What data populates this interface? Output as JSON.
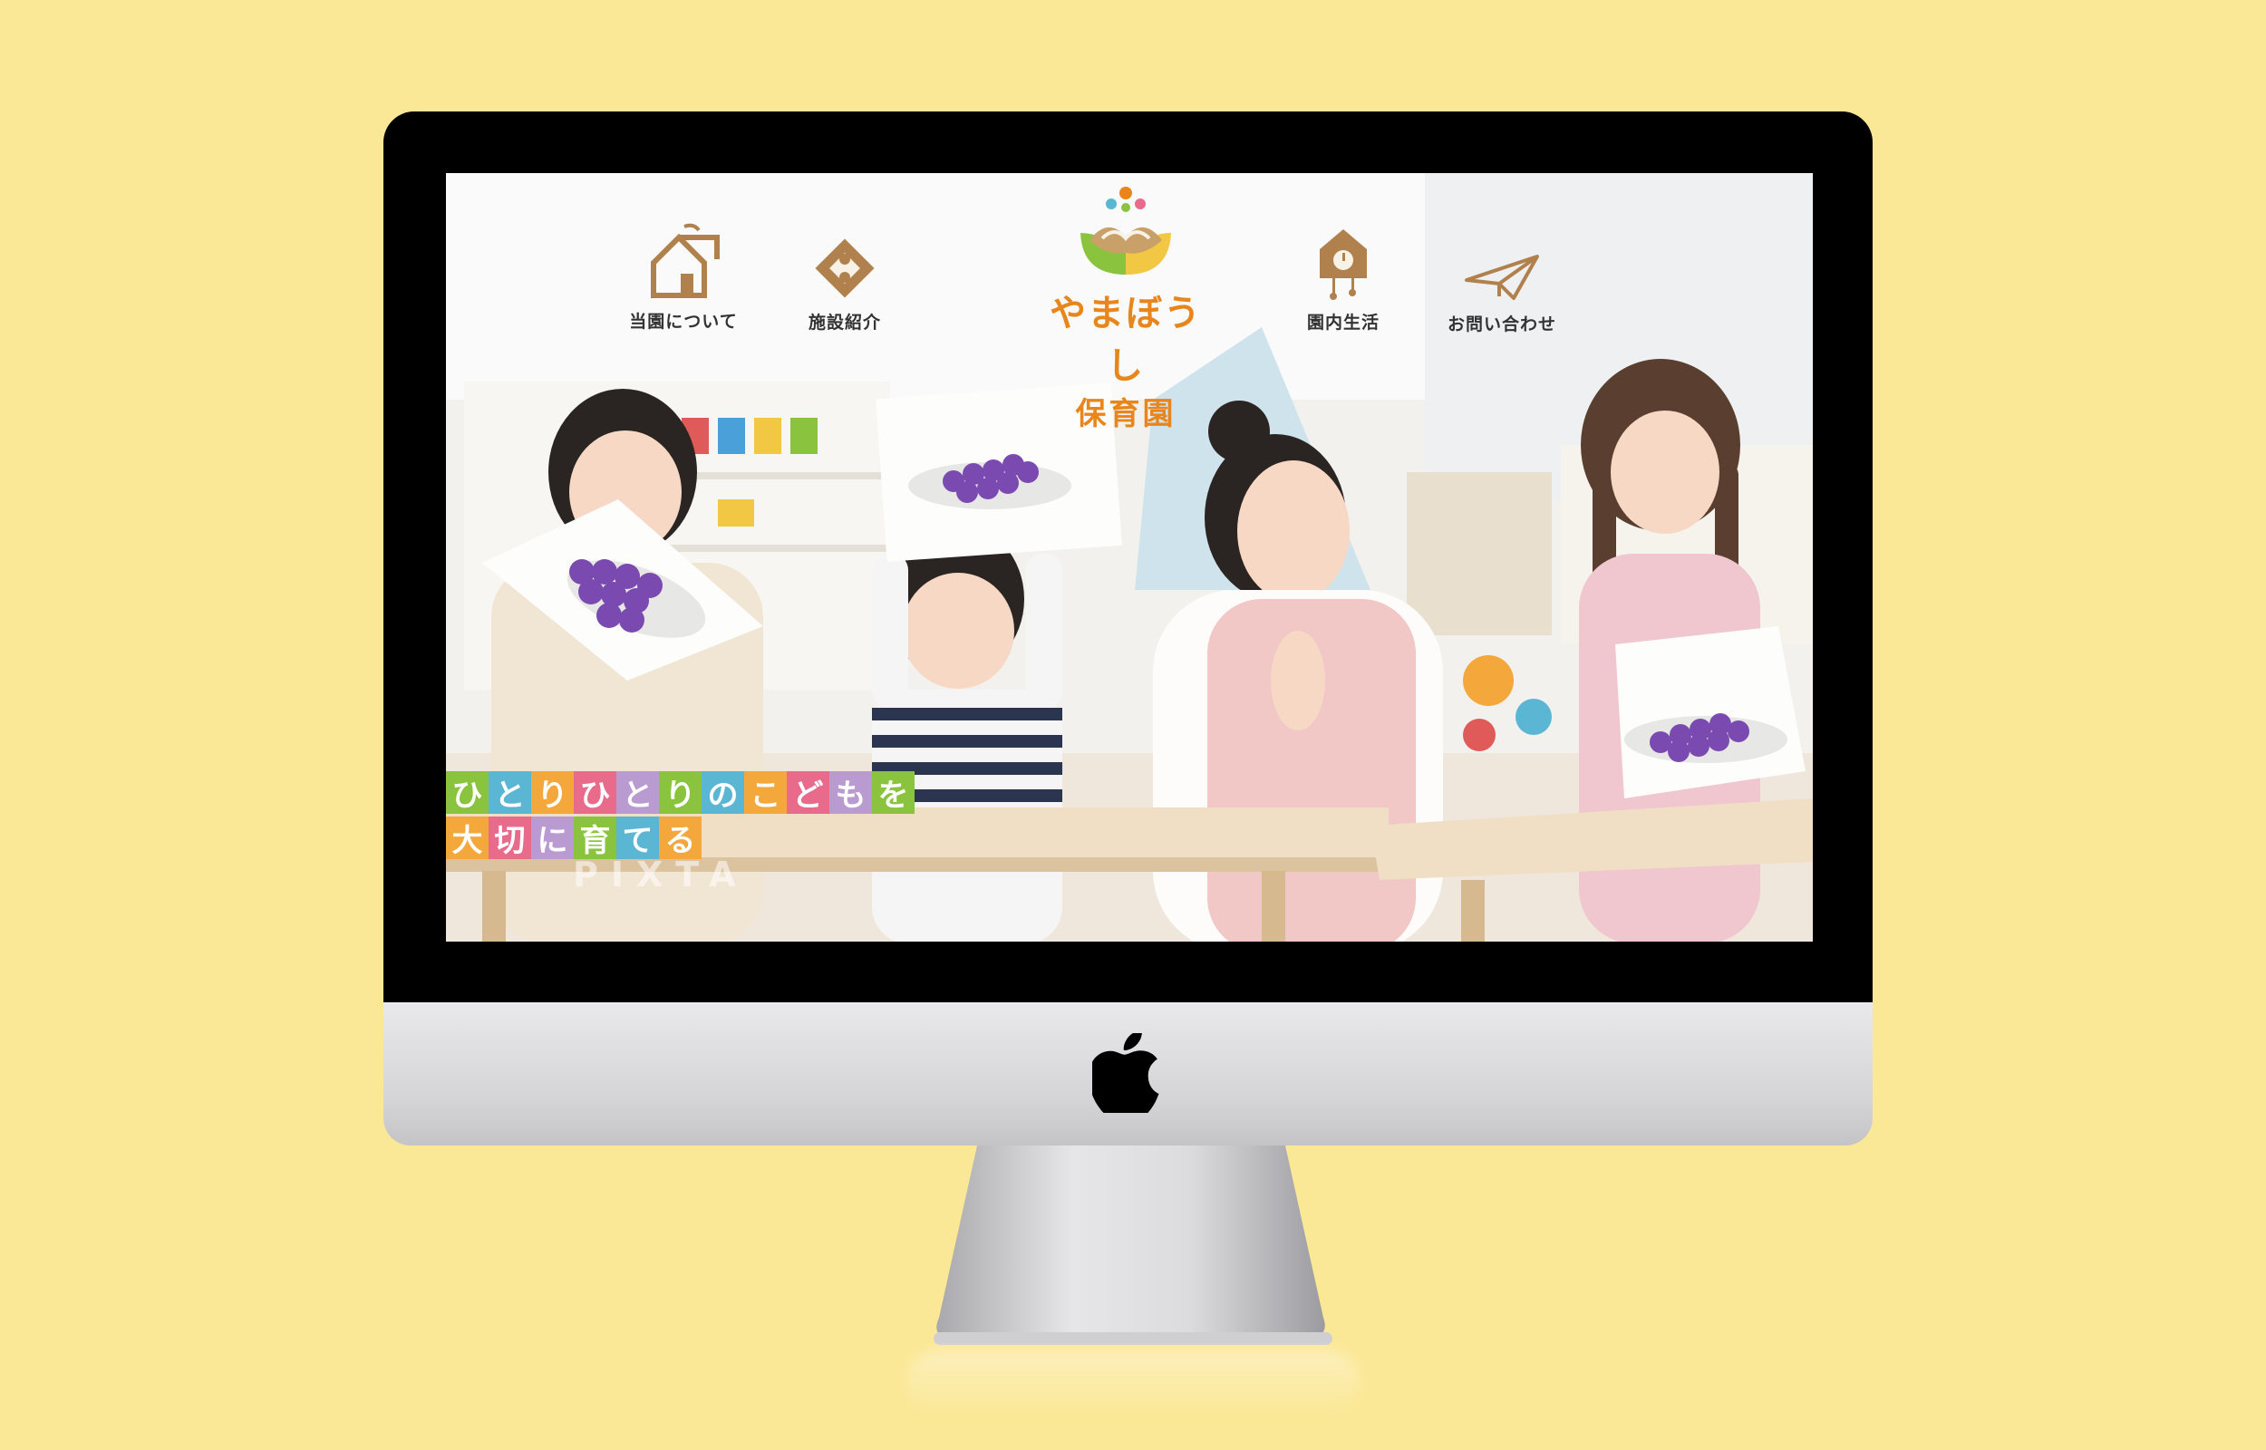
{
  "site": {
    "logo": {
      "line1": "やまぼうし",
      "line2": "保育園"
    },
    "nav": [
      {
        "label": "当園について",
        "icon": "house-icon"
      },
      {
        "label": "施設紹介",
        "icon": "diamond-icon"
      },
      {
        "label": "園内生活",
        "icon": "cuckoo-clock-icon"
      },
      {
        "label": "お問い合わせ",
        "icon": "paper-plane-icon"
      }
    ],
    "catchphrase": {
      "line1": "ひとりひとりのこどもを",
      "line2": "大切に育てる"
    },
    "watermark": "PIXTA"
  },
  "colors": {
    "background": "#fbe897",
    "logo_text": "#e8861c",
    "nav_icon": "#b0814c",
    "catch_tiles": [
      "#8ac43f",
      "#5bb6d4",
      "#f4a73a",
      "#e86b8c",
      "#b99ad1"
    ]
  }
}
